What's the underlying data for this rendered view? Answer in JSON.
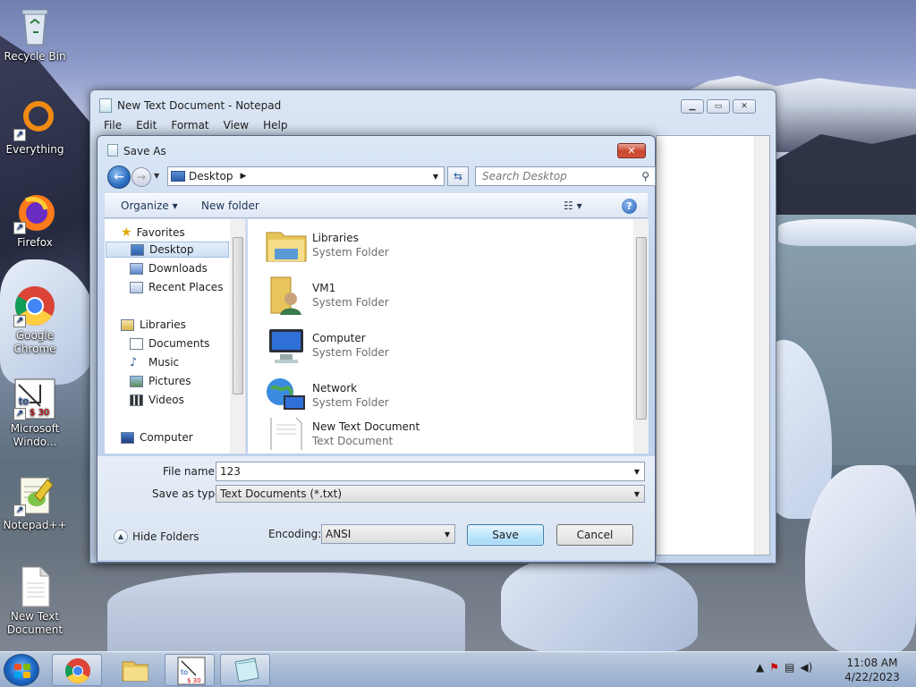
{
  "desktop": {
    "icons": [
      {
        "label": "Recycle Bin"
      },
      {
        "label": "Everything"
      },
      {
        "label": "Firefox"
      },
      {
        "label": "Google Chrome"
      },
      {
        "label": "Microsoft Windo..."
      },
      {
        "label": "Notepad++"
      },
      {
        "label": "New Text Document"
      }
    ]
  },
  "notepad": {
    "title": "New Text Document - Notepad",
    "menu": [
      "File",
      "Edit",
      "Format",
      "View",
      "Help"
    ]
  },
  "dialog": {
    "title": "Save As",
    "address": "Desktop",
    "search_placeholder": "Search Desktop",
    "organize": "Organize",
    "new_folder": "New folder",
    "nav": {
      "favorites": "Favorites",
      "desktop": "Desktop",
      "downloads": "Downloads",
      "recent": "Recent Places",
      "libraries": "Libraries",
      "documents": "Documents",
      "music": "Music",
      "pictures": "Pictures",
      "videos": "Videos",
      "computer": "Computer"
    },
    "files": [
      {
        "name": "Libraries",
        "type": "System Folder"
      },
      {
        "name": "VM1",
        "type": "System Folder"
      },
      {
        "name": "Computer",
        "type": "System Folder"
      },
      {
        "name": "Network",
        "type": "System Folder"
      },
      {
        "name": "New Text Document",
        "type": "Text Document"
      }
    ],
    "file_name_label": "File name:",
    "file_name_value": "123",
    "save_type_label": "Save as type:",
    "save_type_value": "Text Documents (*.txt)",
    "hide_folders": "Hide Folders",
    "encoding_label": "Encoding:",
    "encoding_value": "ANSI",
    "save": "Save",
    "cancel": "Cancel",
    "close_glyph": "✕"
  },
  "taskbar": {
    "time": "11:08 AM",
    "date": "4/22/2023"
  }
}
